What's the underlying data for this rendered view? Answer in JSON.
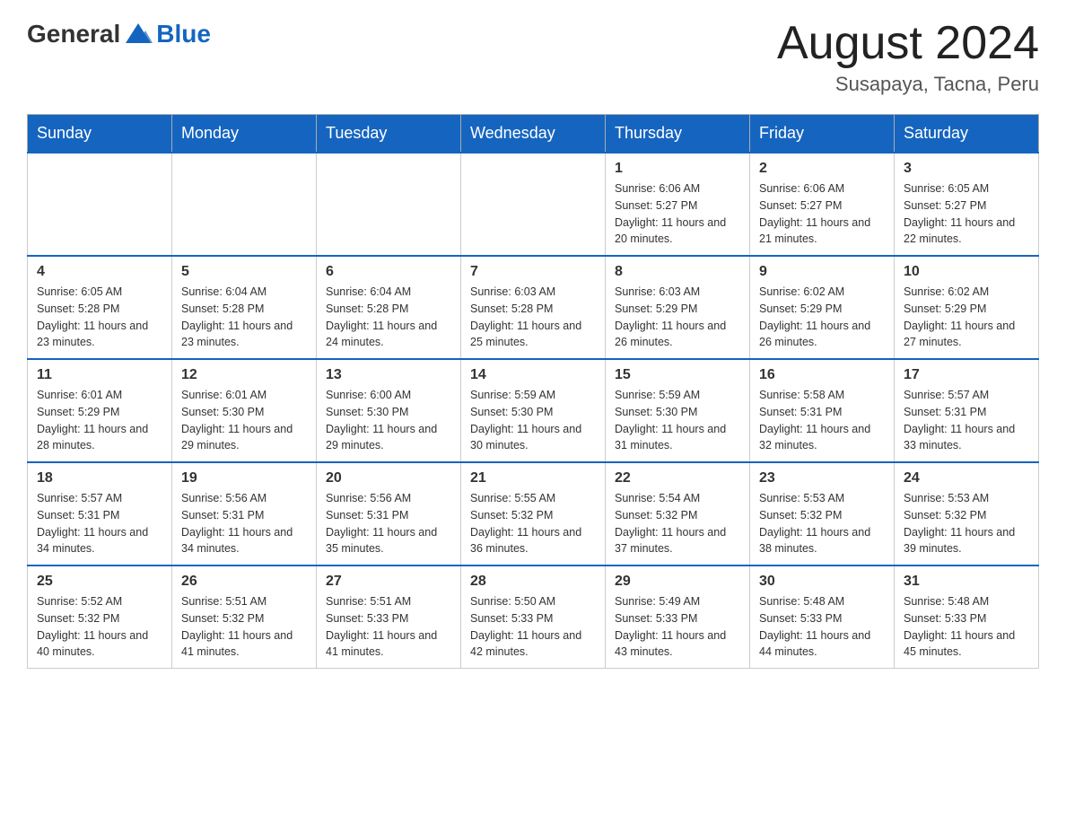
{
  "header": {
    "logo_general": "General",
    "logo_blue": "Blue",
    "title": "August 2024",
    "subtitle": "Susapaya, Tacna, Peru"
  },
  "days_of_week": [
    "Sunday",
    "Monday",
    "Tuesday",
    "Wednesday",
    "Thursday",
    "Friday",
    "Saturday"
  ],
  "weeks": [
    {
      "days": [
        {
          "number": "",
          "sunrise": "",
          "sunset": "",
          "daylight": ""
        },
        {
          "number": "",
          "sunrise": "",
          "sunset": "",
          "daylight": ""
        },
        {
          "number": "",
          "sunrise": "",
          "sunset": "",
          "daylight": ""
        },
        {
          "number": "",
          "sunrise": "",
          "sunset": "",
          "daylight": ""
        },
        {
          "number": "1",
          "sunrise": "Sunrise: 6:06 AM",
          "sunset": "Sunset: 5:27 PM",
          "daylight": "Daylight: 11 hours and 20 minutes."
        },
        {
          "number": "2",
          "sunrise": "Sunrise: 6:06 AM",
          "sunset": "Sunset: 5:27 PM",
          "daylight": "Daylight: 11 hours and 21 minutes."
        },
        {
          "number": "3",
          "sunrise": "Sunrise: 6:05 AM",
          "sunset": "Sunset: 5:27 PM",
          "daylight": "Daylight: 11 hours and 22 minutes."
        }
      ]
    },
    {
      "days": [
        {
          "number": "4",
          "sunrise": "Sunrise: 6:05 AM",
          "sunset": "Sunset: 5:28 PM",
          "daylight": "Daylight: 11 hours and 23 minutes."
        },
        {
          "number": "5",
          "sunrise": "Sunrise: 6:04 AM",
          "sunset": "Sunset: 5:28 PM",
          "daylight": "Daylight: 11 hours and 23 minutes."
        },
        {
          "number": "6",
          "sunrise": "Sunrise: 6:04 AM",
          "sunset": "Sunset: 5:28 PM",
          "daylight": "Daylight: 11 hours and 24 minutes."
        },
        {
          "number": "7",
          "sunrise": "Sunrise: 6:03 AM",
          "sunset": "Sunset: 5:28 PM",
          "daylight": "Daylight: 11 hours and 25 minutes."
        },
        {
          "number": "8",
          "sunrise": "Sunrise: 6:03 AM",
          "sunset": "Sunset: 5:29 PM",
          "daylight": "Daylight: 11 hours and 26 minutes."
        },
        {
          "number": "9",
          "sunrise": "Sunrise: 6:02 AM",
          "sunset": "Sunset: 5:29 PM",
          "daylight": "Daylight: 11 hours and 26 minutes."
        },
        {
          "number": "10",
          "sunrise": "Sunrise: 6:02 AM",
          "sunset": "Sunset: 5:29 PM",
          "daylight": "Daylight: 11 hours and 27 minutes."
        }
      ]
    },
    {
      "days": [
        {
          "number": "11",
          "sunrise": "Sunrise: 6:01 AM",
          "sunset": "Sunset: 5:29 PM",
          "daylight": "Daylight: 11 hours and 28 minutes."
        },
        {
          "number": "12",
          "sunrise": "Sunrise: 6:01 AM",
          "sunset": "Sunset: 5:30 PM",
          "daylight": "Daylight: 11 hours and 29 minutes."
        },
        {
          "number": "13",
          "sunrise": "Sunrise: 6:00 AM",
          "sunset": "Sunset: 5:30 PM",
          "daylight": "Daylight: 11 hours and 29 minutes."
        },
        {
          "number": "14",
          "sunrise": "Sunrise: 5:59 AM",
          "sunset": "Sunset: 5:30 PM",
          "daylight": "Daylight: 11 hours and 30 minutes."
        },
        {
          "number": "15",
          "sunrise": "Sunrise: 5:59 AM",
          "sunset": "Sunset: 5:30 PM",
          "daylight": "Daylight: 11 hours and 31 minutes."
        },
        {
          "number": "16",
          "sunrise": "Sunrise: 5:58 AM",
          "sunset": "Sunset: 5:31 PM",
          "daylight": "Daylight: 11 hours and 32 minutes."
        },
        {
          "number": "17",
          "sunrise": "Sunrise: 5:57 AM",
          "sunset": "Sunset: 5:31 PM",
          "daylight": "Daylight: 11 hours and 33 minutes."
        }
      ]
    },
    {
      "days": [
        {
          "number": "18",
          "sunrise": "Sunrise: 5:57 AM",
          "sunset": "Sunset: 5:31 PM",
          "daylight": "Daylight: 11 hours and 34 minutes."
        },
        {
          "number": "19",
          "sunrise": "Sunrise: 5:56 AM",
          "sunset": "Sunset: 5:31 PM",
          "daylight": "Daylight: 11 hours and 34 minutes."
        },
        {
          "number": "20",
          "sunrise": "Sunrise: 5:56 AM",
          "sunset": "Sunset: 5:31 PM",
          "daylight": "Daylight: 11 hours and 35 minutes."
        },
        {
          "number": "21",
          "sunrise": "Sunrise: 5:55 AM",
          "sunset": "Sunset: 5:32 PM",
          "daylight": "Daylight: 11 hours and 36 minutes."
        },
        {
          "number": "22",
          "sunrise": "Sunrise: 5:54 AM",
          "sunset": "Sunset: 5:32 PM",
          "daylight": "Daylight: 11 hours and 37 minutes."
        },
        {
          "number": "23",
          "sunrise": "Sunrise: 5:53 AM",
          "sunset": "Sunset: 5:32 PM",
          "daylight": "Daylight: 11 hours and 38 minutes."
        },
        {
          "number": "24",
          "sunrise": "Sunrise: 5:53 AM",
          "sunset": "Sunset: 5:32 PM",
          "daylight": "Daylight: 11 hours and 39 minutes."
        }
      ]
    },
    {
      "days": [
        {
          "number": "25",
          "sunrise": "Sunrise: 5:52 AM",
          "sunset": "Sunset: 5:32 PM",
          "daylight": "Daylight: 11 hours and 40 minutes."
        },
        {
          "number": "26",
          "sunrise": "Sunrise: 5:51 AM",
          "sunset": "Sunset: 5:32 PM",
          "daylight": "Daylight: 11 hours and 41 minutes."
        },
        {
          "number": "27",
          "sunrise": "Sunrise: 5:51 AM",
          "sunset": "Sunset: 5:33 PM",
          "daylight": "Daylight: 11 hours and 41 minutes."
        },
        {
          "number": "28",
          "sunrise": "Sunrise: 5:50 AM",
          "sunset": "Sunset: 5:33 PM",
          "daylight": "Daylight: 11 hours and 42 minutes."
        },
        {
          "number": "29",
          "sunrise": "Sunrise: 5:49 AM",
          "sunset": "Sunset: 5:33 PM",
          "daylight": "Daylight: 11 hours and 43 minutes."
        },
        {
          "number": "30",
          "sunrise": "Sunrise: 5:48 AM",
          "sunset": "Sunset: 5:33 PM",
          "daylight": "Daylight: 11 hours and 44 minutes."
        },
        {
          "number": "31",
          "sunrise": "Sunrise: 5:48 AM",
          "sunset": "Sunset: 5:33 PM",
          "daylight": "Daylight: 11 hours and 45 minutes."
        }
      ]
    }
  ]
}
